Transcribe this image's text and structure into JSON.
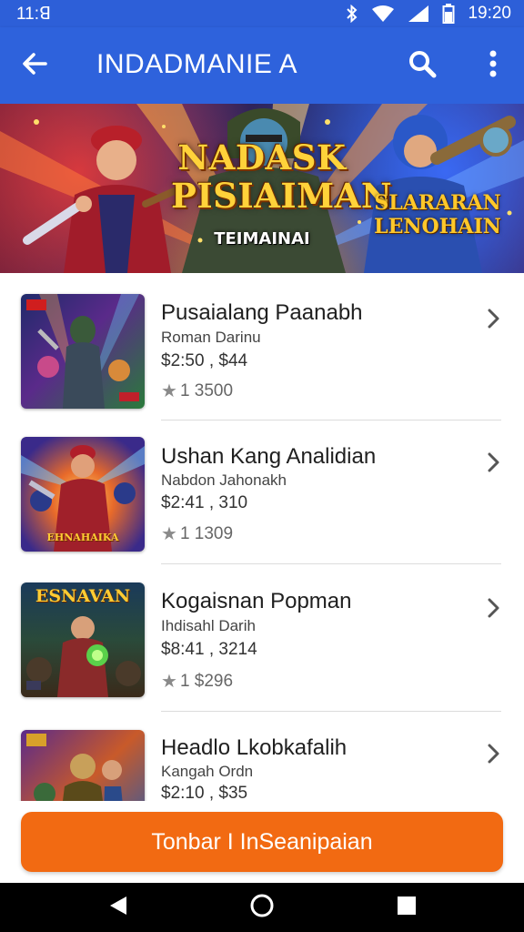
{
  "status_bar": {
    "time_left": "11:ꓭ",
    "time_right": "19:20"
  },
  "app_bar": {
    "title": "INDADMANIE A"
  },
  "banner": {
    "title_line1": "NADASK",
    "title_line2": "PISIAIMAN",
    "subtitle": "TEIMAINAI",
    "side_line1": "SLARARAN",
    "side_line2": "LENOHAIN"
  },
  "items": [
    {
      "name": "Pusaialang Paanabh",
      "subtitle": "Roman Darinu",
      "price": "$2:50 , $44",
      "rating": "1 3500",
      "thumb_badge": "",
      "thumb_caption": ""
    },
    {
      "name": "Ushan Kang Analidian",
      "subtitle": "Nabdon Jahonakh",
      "price": "$2:41 , 310",
      "rating": "1 1309",
      "thumb_badge": "",
      "thumb_caption": "EHNAHAIKA"
    },
    {
      "name": "Kogaisnan Popman",
      "subtitle": "Ihdisahl Darih",
      "price": "$8:41 , 3214",
      "rating": "1 $296",
      "thumb_badge": "ESNAVAN",
      "thumb_caption": ""
    },
    {
      "name": "Headlo Lkobkafalih",
      "subtitle": "Kangah Ordn",
      "price": "$2:10 , $35",
      "rating": "",
      "thumb_badge": "",
      "thumb_caption": ""
    }
  ],
  "cta": {
    "label": "Tonbar I InSeanipaian"
  },
  "icons": {
    "back": "arrow-back-icon",
    "search": "search-icon",
    "more": "more-vert-icon",
    "chevron": "chevron-right-icon",
    "star": "star-icon",
    "nav_back": "nav-back-icon",
    "nav_home": "nav-home-icon",
    "nav_recents": "nav-recents-icon"
  },
  "colors": {
    "primary": "#2e62dc",
    "status_bar": "#2d5fd8",
    "accent": "#f26a12",
    "nav_bar": "#000000"
  }
}
